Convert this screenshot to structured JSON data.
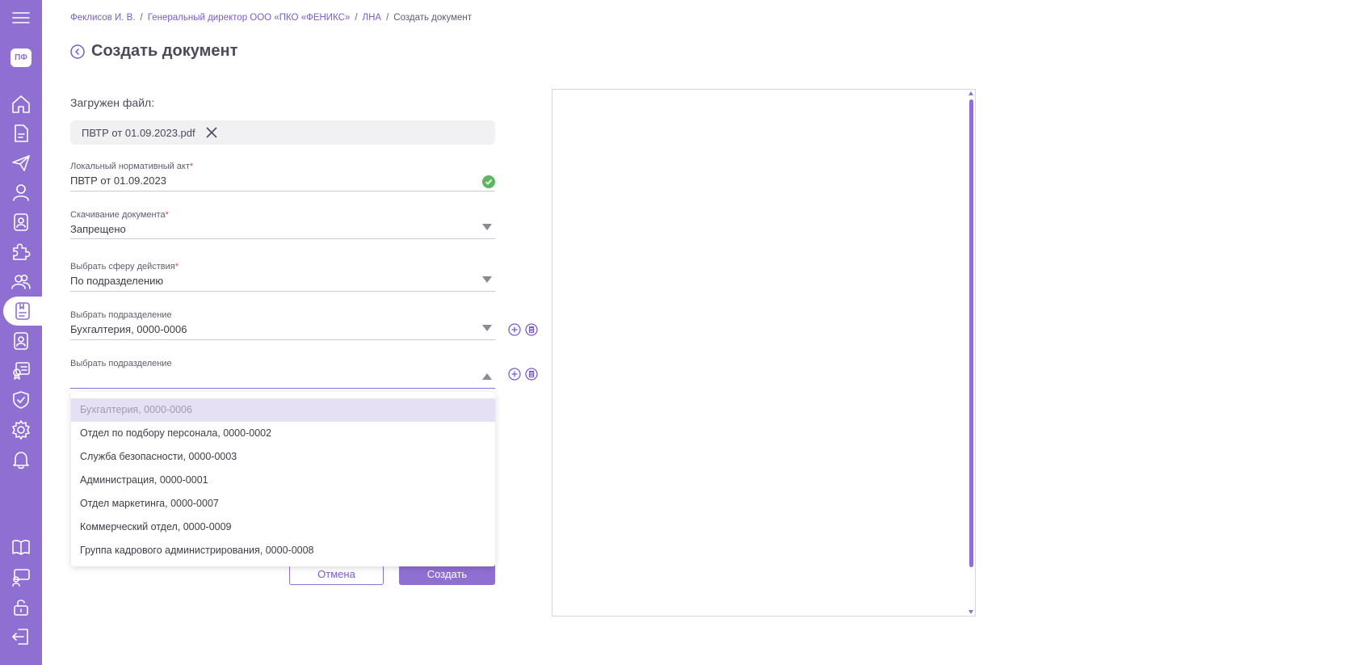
{
  "sidebar": {
    "avatar_initials": "ПФ",
    "items": [
      {
        "icon": "menu-icon"
      },
      {
        "icon": "home-icon"
      },
      {
        "icon": "document-icon"
      },
      {
        "icon": "send-icon"
      },
      {
        "icon": "user-icon"
      },
      {
        "icon": "badge-icon"
      },
      {
        "icon": "puzzle-icon"
      },
      {
        "icon": "users-icon"
      },
      {
        "icon": "lna-icon",
        "active": true
      },
      {
        "icon": "contacts-icon"
      },
      {
        "icon": "certificate-icon"
      },
      {
        "icon": "shield-icon"
      },
      {
        "icon": "gear-icon"
      },
      {
        "icon": "bell-icon"
      },
      {
        "icon": "book-icon"
      },
      {
        "icon": "presentation-icon"
      },
      {
        "icon": "unlock-icon"
      },
      {
        "icon": "logout-icon"
      }
    ]
  },
  "breadcrumb": {
    "items": [
      "Феклисов И. В.",
      "Генеральный директор ООО «ПКО «ФЕНИКС»",
      "ЛНА"
    ],
    "current": "Создать документ",
    "separator": "/"
  },
  "page_title": "Создать документ",
  "loaded_file": {
    "label": "Загружен файл:",
    "name": "ПВТР от 01.09.2023.pdf"
  },
  "fields": {
    "lna": {
      "label": "Локальный нормативный акт",
      "value": "ПВТР от 01.09.2023"
    },
    "download": {
      "label": "Скачивание документа",
      "value": "Запрещено"
    },
    "scope": {
      "label": "Выбрать сферу действия",
      "value": "По подразделению"
    },
    "dept1": {
      "label": "Выбрать подразделение",
      "value": "Бухгалтерия, 0000-0006"
    },
    "dept2": {
      "label": "Выбрать подразделение",
      "value": ""
    }
  },
  "required_mark": "*",
  "dropdown_options": [
    "Бухгалтерия, 0000-0006",
    "Отдел по подбору персонала, 0000-0002",
    "Служба безопасности, 0000-0003",
    "Администрация, 0000-0001",
    "Отдел маркетинга, 0000-0007",
    "Коммерческий отдел, 0000-0009",
    "Группа кадрового администрирования, 0000-0008"
  ],
  "buttons": {
    "cancel": "Отмена",
    "create": "Создать"
  },
  "colors": {
    "accent": "#8f6fd1",
    "success": "#5cb85c",
    "required": "#e04848"
  }
}
